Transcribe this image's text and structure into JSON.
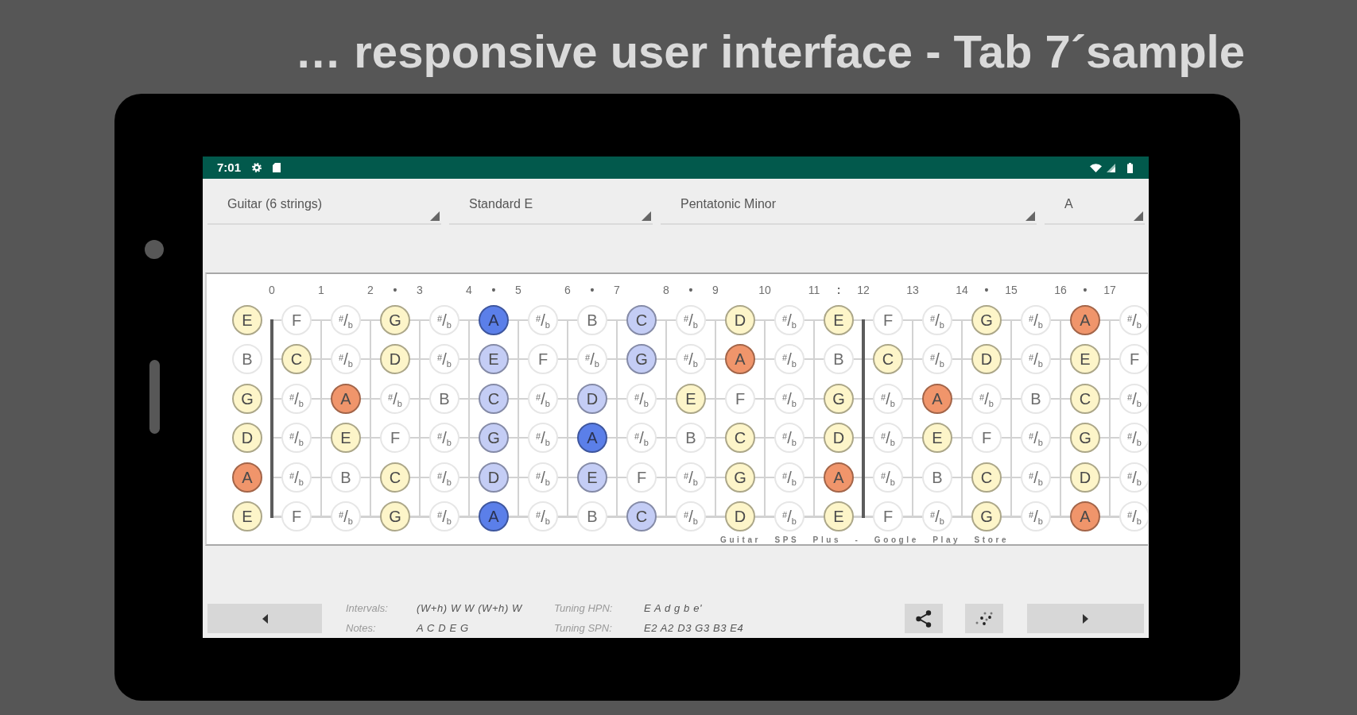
{
  "banner": {
    "title": "… responsive user interface - Tab 7´sample"
  },
  "status_bar": {
    "time": "7:01"
  },
  "selectors": [
    {
      "value": "Guitar (6 strings)"
    },
    {
      "value": "Standard E"
    },
    {
      "value": "Pentatonic Minor"
    },
    {
      "value": "A"
    }
  ],
  "fretboard": {
    "frets": [
      {
        "number": "0"
      },
      {
        "number": "1"
      },
      {
        "number": "2"
      },
      {
        "number": "3",
        "inlay": "•"
      },
      {
        "number": "4"
      },
      {
        "number": "5",
        "inlay": "•"
      },
      {
        "number": "6"
      },
      {
        "number": "7",
        "inlay": "•"
      },
      {
        "number": "8"
      },
      {
        "number": "9",
        "inlay": "•"
      },
      {
        "number": "10"
      },
      {
        "number": "11"
      },
      {
        "number": "12",
        "inlay": ":"
      },
      {
        "number": "13"
      },
      {
        "number": "14"
      },
      {
        "number": "15",
        "inlay": "•"
      },
      {
        "number": "16"
      },
      {
        "number": "17",
        "inlay": "•"
      }
    ],
    "strings": [
      {
        "notes": [
          {
            "name": "E",
            "color": "#fdf5c9"
          },
          {
            "name": "F",
            "color": "#ffffff"
          },
          {
            "name": "$^{#}$/$_{b}$",
            "color": "#ffffff"
          },
          {
            "name": "G",
            "color": "#fdf5c9"
          },
          {
            "name": "$^{#}$/$_{b}$",
            "color": "#ffffff"
          },
          {
            "name": "A",
            "color": "#5b7fe9"
          },
          {
            "name": "$^{#}$/$_{b}$",
            "color": "#ffffff"
          },
          {
            "name": "B",
            "color": "#ffffff"
          },
          {
            "name": "C",
            "color": "#c4cdf5"
          },
          {
            "name": "$^{#}$/$_{b}$",
            "color": "#ffffff"
          },
          {
            "name": "D",
            "color": "#fdf5c9"
          },
          {
            "name": "$^{#}$/$_{b}$",
            "color": "#ffffff"
          },
          {
            "name": "E",
            "color": "#fdf5c9"
          },
          {
            "name": "F",
            "color": "#ffffff"
          },
          {
            "name": "$^{#}$/$_{b}$",
            "color": "#ffffff"
          },
          {
            "name": "G",
            "color": "#fdf5c9"
          },
          {
            "name": "$^{#}$/$_{b}$",
            "color": "#ffffff"
          },
          {
            "name": "A",
            "color": "#f0956b"
          },
          {
            "name": "$^{#}$/$_{b}$",
            "color": "#ffffff"
          }
        ]
      },
      {
        "notes": [
          {
            "name": "B",
            "color": "#ffffff"
          },
          {
            "name": "C",
            "color": "#fdf5c9"
          },
          {
            "name": "$^{#}$/$_{b}$",
            "color": "#ffffff"
          },
          {
            "name": "D",
            "color": "#fdf5c9"
          },
          {
            "name": "$^{#}$/$_{b}$",
            "color": "#ffffff"
          },
          {
            "name": "E",
            "color": "#c4cdf5"
          },
          {
            "name": "F",
            "color": "#ffffff"
          },
          {
            "name": "$^{#}$/$_{b}$",
            "color": "#ffffff"
          },
          {
            "name": "G",
            "color": "#c4cdf5"
          },
          {
            "name": "$^{#}$/$_{b}$",
            "color": "#ffffff"
          },
          {
            "name": "A",
            "color": "#f0956b"
          },
          {
            "name": "$^{#}$/$_{b}$",
            "color": "#ffffff"
          },
          {
            "name": "B",
            "color": "#ffffff"
          },
          {
            "name": "C",
            "color": "#fdf5c9"
          },
          {
            "name": "$^{#}$/$_{b}$",
            "color": "#ffffff"
          },
          {
            "name": "D",
            "color": "#fdf5c9"
          },
          {
            "name": "$^{#}$/$_{b}$",
            "color": "#ffffff"
          },
          {
            "name": "E",
            "color": "#fdf5c9"
          },
          {
            "name": "F",
            "color": "#ffffff"
          }
        ]
      },
      {
        "notes": [
          {
            "name": "G",
            "color": "#fdf5c9"
          },
          {
            "name": "$^{#}$/$_{b}$",
            "color": "#ffffff"
          },
          {
            "name": "A",
            "color": "#f0956b"
          },
          {
            "name": "$^{#}$/$_{b}$",
            "color": "#ffffff"
          },
          {
            "name": "B",
            "color": "#ffffff"
          },
          {
            "name": "C",
            "color": "#c4cdf5"
          },
          {
            "name": "$^{#}$/$_{b}$",
            "color": "#ffffff"
          },
          {
            "name": "D",
            "color": "#c4cdf5"
          },
          {
            "name": "$^{#}$/$_{b}$",
            "color": "#ffffff"
          },
          {
            "name": "E",
            "color": "#fdf5c9"
          },
          {
            "name": "F",
            "color": "#ffffff"
          },
          {
            "name": "$^{#}$/$_{b}$",
            "color": "#ffffff"
          },
          {
            "name": "G",
            "color": "#fdf5c9"
          },
          {
            "name": "$^{#}$/$_{b}$",
            "color": "#ffffff"
          },
          {
            "name": "A",
            "color": "#f0956b"
          },
          {
            "name": "$^{#}$/$_{b}$",
            "color": "#ffffff"
          },
          {
            "name": "B",
            "color": "#ffffff"
          },
          {
            "name": "C",
            "color": "#fdf5c9"
          },
          {
            "name": "$^{#}$/$_{b}$",
            "color": "#ffffff"
          }
        ]
      },
      {
        "notes": [
          {
            "name": "D",
            "color": "#fdf5c9"
          },
          {
            "name": "$^{#}$/$_{b}$",
            "color": "#ffffff"
          },
          {
            "name": "E",
            "color": "#fdf5c9"
          },
          {
            "name": "F",
            "color": "#ffffff"
          },
          {
            "name": "$^{#}$/$_{b}$",
            "color": "#ffffff"
          },
          {
            "name": "G",
            "color": "#c4cdf5"
          },
          {
            "name": "$^{#}$/$_{b}$",
            "color": "#ffffff"
          },
          {
            "name": "A",
            "color": "#5b7fe9"
          },
          {
            "name": "$^{#}$/$_{b}$",
            "color": "#ffffff"
          },
          {
            "name": "B",
            "color": "#ffffff"
          },
          {
            "name": "C",
            "color": "#fdf5c9"
          },
          {
            "name": "$^{#}$/$_{b}$",
            "color": "#ffffff"
          },
          {
            "name": "D",
            "color": "#fdf5c9"
          },
          {
            "name": "$^{#}$/$_{b}$",
            "color": "#ffffff"
          },
          {
            "name": "E",
            "color": "#fdf5c9"
          },
          {
            "name": "F",
            "color": "#ffffff"
          },
          {
            "name": "$^{#}$/$_{b}$",
            "color": "#ffffff"
          },
          {
            "name": "G",
            "color": "#fdf5c9"
          },
          {
            "name": "$^{#}$/$_{b}$",
            "color": "#ffffff"
          }
        ]
      },
      {
        "notes": [
          {
            "name": "A",
            "color": "#f0956b"
          },
          {
            "name": "$^{#}$/$_{b}$",
            "color": "#ffffff"
          },
          {
            "name": "B",
            "color": "#ffffff"
          },
          {
            "name": "C",
            "color": "#fdf5c9"
          },
          {
            "name": "$^{#}$/$_{b}$",
            "color": "#ffffff"
          },
          {
            "name": "D",
            "color": "#c4cdf5"
          },
          {
            "name": "$^{#}$/$_{b}$",
            "color": "#ffffff"
          },
          {
            "name": "E",
            "color": "#c4cdf5"
          },
          {
            "name": "F",
            "color": "#ffffff"
          },
          {
            "name": "$^{#}$/$_{b}$",
            "color": "#ffffff"
          },
          {
            "name": "G",
            "color": "#fdf5c9"
          },
          {
            "name": "$^{#}$/$_{b}$",
            "color": "#ffffff"
          },
          {
            "name": "A",
            "color": "#f0956b"
          },
          {
            "name": "$^{#}$/$_{b}$",
            "color": "#ffffff"
          },
          {
            "name": "B",
            "color": "#ffffff"
          },
          {
            "name": "C",
            "color": "#fdf5c9"
          },
          {
            "name": "$^{#}$/$_{b}$",
            "color": "#ffffff"
          },
          {
            "name": "D",
            "color": "#fdf5c9"
          },
          {
            "name": "$^{#}$/$_{b}$",
            "color": "#ffffff"
          }
        ]
      },
      {
        "notes": [
          {
            "name": "E",
            "color": "#fdf5c9"
          },
          {
            "name": "F",
            "color": "#ffffff"
          },
          {
            "name": "$^{#}$/$_{b}$",
            "color": "#ffffff"
          },
          {
            "name": "G",
            "color": "#fdf5c9"
          },
          {
            "name": "$^{#}$/$_{b}$",
            "color": "#ffffff"
          },
          {
            "name": "A",
            "color": "#5b7fe9"
          },
          {
            "name": "$^{#}$/$_{b}$",
            "color": "#ffffff"
          },
          {
            "name": "B",
            "color": "#ffffff"
          },
          {
            "name": "C",
            "color": "#c4cdf5"
          },
          {
            "name": "$^{#}$/$_{b}$",
            "color": "#ffffff"
          },
          {
            "name": "D",
            "color": "#fdf5c9"
          },
          {
            "name": "$^{#}$/$_{b}$",
            "color": "#ffffff"
          },
          {
            "name": "E",
            "color": "#fdf5c9"
          },
          {
            "name": "F",
            "color": "#ffffff"
          },
          {
            "name": "$^{#}$/$_{b}$",
            "color": "#ffffff"
          },
          {
            "name": "G",
            "color": "#fdf5c9"
          },
          {
            "name": "$^{#}$/$_{b}$",
            "color": "#ffffff"
          },
          {
            "name": "A",
            "color": "#f0956b"
          },
          {
            "name": "$^{#}$/$_{b}$",
            "color": "#ffffff"
          }
        ]
      }
    ],
    "credit": "Guitar SPS Plus - Google Play Store"
  },
  "info": [
    {
      "label": "Intervals:",
      "value": "(W+h) W W (W+h) W"
    },
    {
      "label": "Tuning HPN:",
      "value": "E A d g b e'"
    },
    {
      "label": "Notes:",
      "value": "A C D E G"
    },
    {
      "label": "Tuning SPN:",
      "value": "E2 A2 D3 G3 B3 E4"
    }
  ]
}
